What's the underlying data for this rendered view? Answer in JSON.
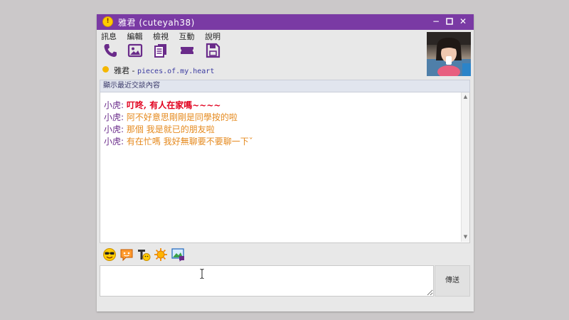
{
  "window": {
    "title": "雅君 (cuteyah38)",
    "accent_color": "#7a3aa4",
    "controls": {
      "minimize": "−",
      "maximize": "▫",
      "close": "✕"
    }
  },
  "menu": [
    "訊息",
    "編輯",
    "檢視",
    "互動",
    "說明"
  ],
  "toolbar": {
    "icons": [
      "phone-icon",
      "image-icon",
      "documents-icon",
      "ticket-icon",
      "save-icon"
    ]
  },
  "contact": {
    "name": "雅君",
    "separator": " - ",
    "status_message": "pieces.of.my.heart",
    "status_color": "#f5b700"
  },
  "history": {
    "label": "顯示最近交談內容"
  },
  "messages": [
    {
      "sender": "小虎:",
      "text": "叮咚, 有人在家嗎~~~~",
      "style": "red"
    },
    {
      "sender": "小虎:",
      "text": "阿不好意思剛剛是同學按的啦",
      "style": "orange"
    },
    {
      "sender": "小虎:",
      "text": "那個  我是就已的朋友啦",
      "style": "orange"
    },
    {
      "sender": "小虎:",
      "text": "有在忙嗎  我好無聊要不要聊一下ˇ",
      "style": "orange"
    }
  ],
  "emoji_bar": {
    "icons": [
      "smiley-sunglasses-icon",
      "speech-bubble-icon",
      "font-icon",
      "sun-icon",
      "photo-share-icon"
    ]
  },
  "compose": {
    "value": "",
    "send_label": "傳送"
  }
}
